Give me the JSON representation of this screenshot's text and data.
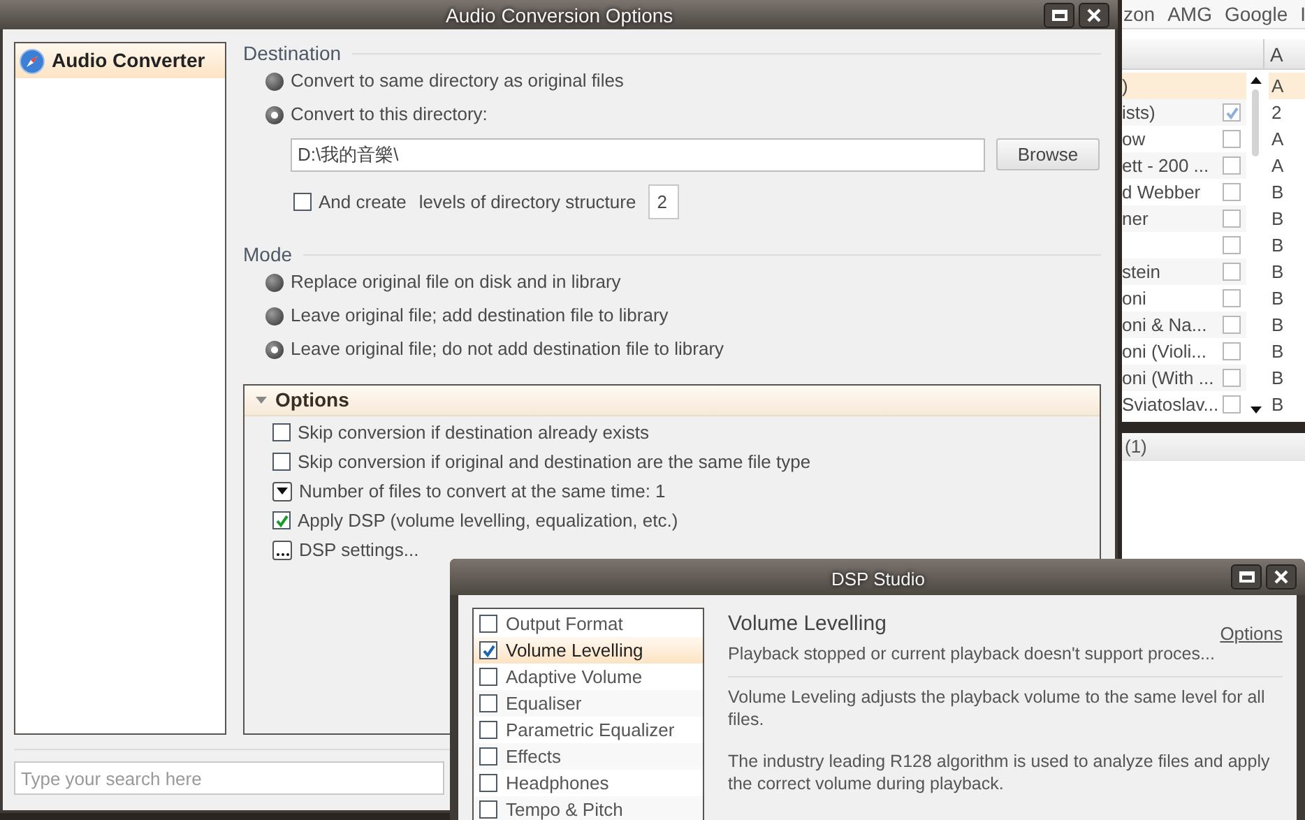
{
  "main_window": {
    "title": "Audio Conversion Options",
    "sidebar": {
      "items": [
        {
          "label": "Audio Converter",
          "selected": true
        }
      ]
    },
    "destination": {
      "heading": "Destination",
      "options": [
        {
          "label": "Convert to same directory as original files",
          "selected": false
        },
        {
          "label": "Convert to this directory:",
          "selected": true
        }
      ],
      "directory": {
        "value": "D:\\我的音樂\\"
      },
      "browse_button": "Browse",
      "create_levels": {
        "label_before": "And create",
        "label_after": "levels of directory structure",
        "checked": false,
        "value": "2"
      }
    },
    "mode": {
      "heading": "Mode",
      "options": [
        {
          "label": "Replace original file on disk and in library",
          "selected": false
        },
        {
          "label": "Leave original file; add destination file to library",
          "selected": false
        },
        {
          "label": "Leave original file; do not add destination file to library",
          "selected": true
        }
      ]
    },
    "options": {
      "heading": "Options",
      "expanded": true,
      "items": [
        {
          "kind": "checkbox",
          "label": "Skip conversion if destination already exists",
          "checked": false
        },
        {
          "kind": "checkbox",
          "label": "Skip conversion if original and destination are the same file type",
          "checked": false
        },
        {
          "kind": "dropdown",
          "label": "Number of files to convert at the same time: 1"
        },
        {
          "kind": "checkbox",
          "label": "Apply DSP (volume levelling, equalization, etc.)",
          "checked": true
        },
        {
          "kind": "ellipsis",
          "label": "DSP settings..."
        }
      ]
    },
    "search": {
      "placeholder": "Type your search here"
    }
  },
  "background_app": {
    "menu": [
      "zon",
      "AMG",
      "Google",
      "I"
    ],
    "column_header": "A",
    "rows": [
      {
        "kind": "group",
        "label": ")",
        "column_3": "A",
        "selected": true
      },
      {
        "kind": "item",
        "label": "ists)",
        "checked": true,
        "column_3": "2",
        "selected": false
      },
      {
        "kind": "item",
        "label": "ow",
        "checked": false,
        "column_3": "A",
        "selected": false
      },
      {
        "kind": "item",
        "label": "ett - 200 ...",
        "checked": false,
        "column_3": "A",
        "selected": false
      },
      {
        "kind": "item",
        "label": "d Webber",
        "checked": false,
        "column_3": "B",
        "selected": false
      },
      {
        "kind": "item",
        "label": "ner",
        "checked": false,
        "column_3": "B",
        "selected": false
      },
      {
        "kind": "item",
        "checked": false,
        "column_3": "B",
        "selected": false
      },
      {
        "kind": "item",
        "label": "stein",
        "checked": false,
        "column_3": "B",
        "selected": false
      },
      {
        "kind": "item",
        "label": "oni",
        "checked": false,
        "column_3": "B",
        "selected": false
      },
      {
        "kind": "item",
        "label": "oni & Na...",
        "checked": false,
        "column_3": "B",
        "selected": false
      },
      {
        "kind": "item",
        "label": "oni (Violi...",
        "checked": false,
        "column_3": "B",
        "selected": false
      },
      {
        "kind": "item",
        "label": "oni (With ...",
        "checked": false,
        "column_3": "B",
        "selected": false
      },
      {
        "kind": "item",
        "label": "Sviatoslav...",
        "checked": false,
        "column_3": "B",
        "selected": false
      }
    ],
    "footer": "(1)"
  },
  "dsp_studio": {
    "title": "DSP Studio",
    "modules": [
      {
        "label": "Output Format",
        "checked": false,
        "selected": false
      },
      {
        "label": "Volume Levelling",
        "checked": true,
        "selected": true
      },
      {
        "label": "Adaptive Volume",
        "checked": false,
        "selected": false
      },
      {
        "label": "Equaliser",
        "checked": false,
        "selected": false
      },
      {
        "label": "Parametric Equalizer",
        "checked": false,
        "selected": false
      },
      {
        "label": "Effects",
        "checked": false,
        "selected": false
      },
      {
        "label": "Headphones",
        "checked": false,
        "selected": false
      },
      {
        "label": "Tempo & Pitch",
        "checked": false,
        "selected": false
      }
    ],
    "heading": "Volume Levelling",
    "status": "Playback stopped or current playback doesn't support proces...",
    "options_link": "Options",
    "paragraphs": [
      "Volume Leveling adjusts the playback volume to the same level for all files.",
      "The industry leading R128 algorithm is used to analyze files and apply the correct volume during playback."
    ]
  }
}
